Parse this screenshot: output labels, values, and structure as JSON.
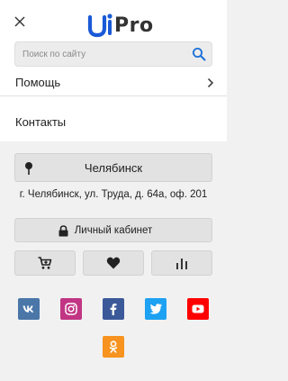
{
  "header": {
    "logo_brand_letters": "Pro",
    "search": {
      "placeholder": "Поиск по сайту",
      "value": ""
    }
  },
  "menu": {
    "items": [
      {
        "label": "Помощь",
        "has_submenu": true
      },
      {
        "label": "Контакты",
        "has_submenu": false
      }
    ]
  },
  "location": {
    "city": "Челябинск",
    "address": "г. Челябинск, ул. Труда, д. 64а, оф. 201"
  },
  "account": {
    "cabinet_label": "Личный кабинет"
  },
  "quick_actions": [
    {
      "icon": "cart-icon"
    },
    {
      "icon": "heart-icon"
    },
    {
      "icon": "compare-icon"
    }
  ],
  "social": [
    {
      "name": "vk",
      "color": "#4a76a8"
    },
    {
      "name": "instagram",
      "color": "#c13584"
    },
    {
      "name": "facebook",
      "color": "#3b5998"
    },
    {
      "name": "twitter",
      "color": "#1da1f2"
    },
    {
      "name": "youtube",
      "color": "#ff0000"
    },
    {
      "name": "odnoklassniki",
      "color": "#f7931e"
    }
  ],
  "colors": {
    "brand_blue": "#1a5ad7",
    "accent": "#1a6fd8"
  }
}
